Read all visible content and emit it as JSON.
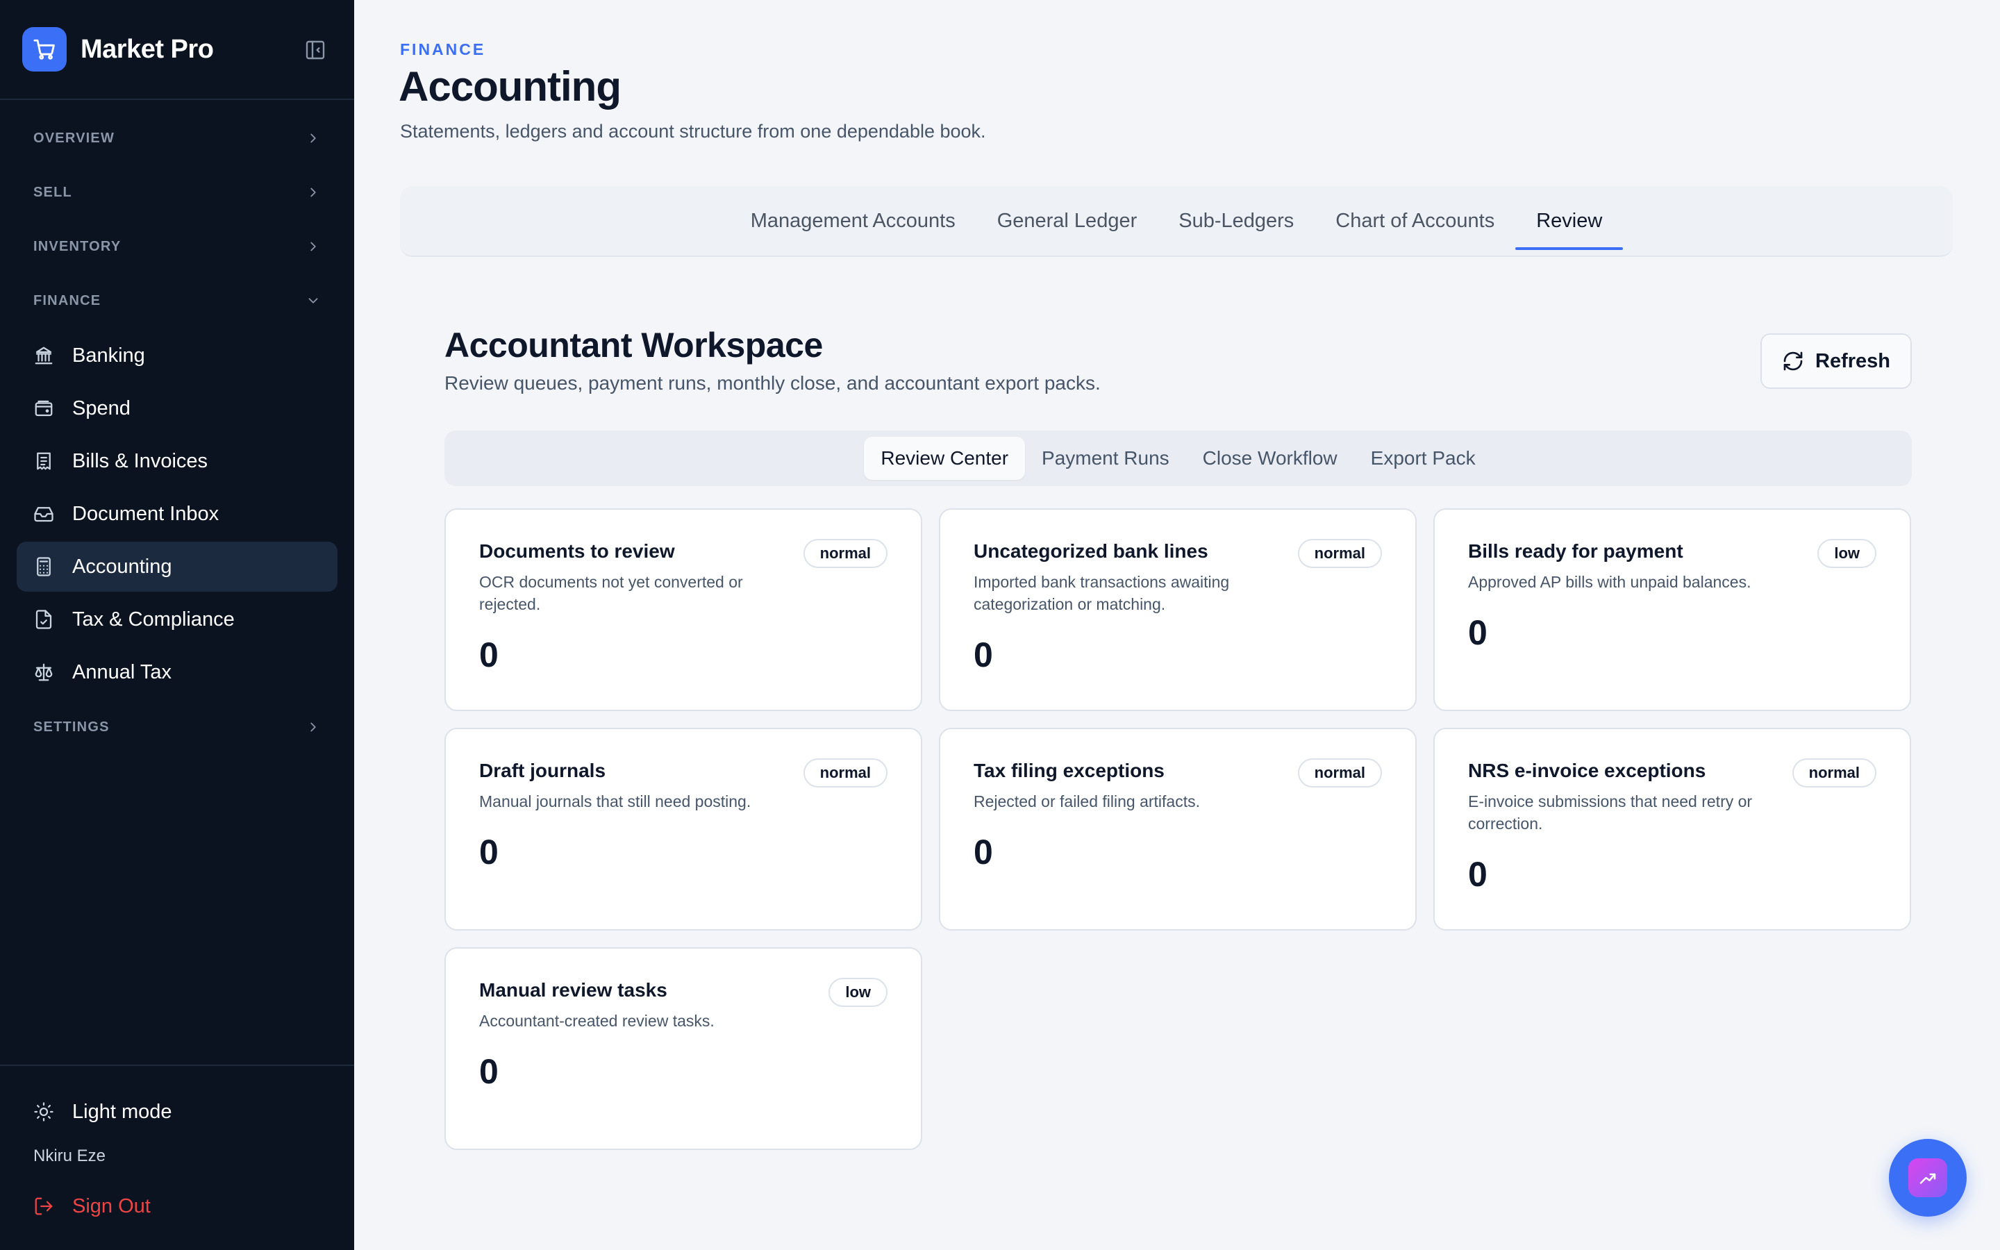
{
  "app": {
    "name": "Market Pro"
  },
  "sidebar": {
    "sections": {
      "overview": "OVERVIEW",
      "sell": "SELL",
      "inventory": "INVENTORY",
      "finance": "FINANCE",
      "settings": "SETTINGS"
    },
    "finance_items": [
      {
        "label": "Banking",
        "icon": "bank-icon"
      },
      {
        "label": "Spend",
        "icon": "wallet-icon"
      },
      {
        "label": "Bills & Invoices",
        "icon": "receipt-icon"
      },
      {
        "label": "Document Inbox",
        "icon": "inbox-icon"
      },
      {
        "label": "Accounting",
        "icon": "calculator-icon",
        "active": true
      },
      {
        "label": "Tax & Compliance",
        "icon": "file-check-icon"
      },
      {
        "label": "Annual Tax",
        "icon": "scale-icon"
      }
    ],
    "theme_label": "Light mode",
    "user_name": "Nkiru Eze",
    "signout_label": "Sign Out"
  },
  "header": {
    "eyebrow": "FINANCE",
    "title": "Accounting",
    "subtitle": "Statements, ledgers and account structure from one dependable book."
  },
  "tabs": [
    {
      "label": "Management Accounts"
    },
    {
      "label": "General Ledger"
    },
    {
      "label": "Sub-Ledgers"
    },
    {
      "label": "Chart of Accounts"
    },
    {
      "label": "Review",
      "active": true
    }
  ],
  "workspace": {
    "title": "Accountant Workspace",
    "subtitle": "Review queues, payment runs, monthly close, and accountant export packs.",
    "refresh_label": "Refresh",
    "subtabs": [
      {
        "label": "Review Center",
        "active": true
      },
      {
        "label": "Payment Runs"
      },
      {
        "label": "Close Workflow"
      },
      {
        "label": "Export Pack"
      }
    ],
    "cards": [
      {
        "title": "Documents to review",
        "desc": "OCR documents not yet converted or rejected.",
        "badge": "normal",
        "value": "0"
      },
      {
        "title": "Uncategorized bank lines",
        "desc": "Imported bank transactions awaiting categorization or matching.",
        "badge": "normal",
        "value": "0"
      },
      {
        "title": "Bills ready for payment",
        "desc": "Approved AP bills with unpaid balances.",
        "badge": "low",
        "value": "0"
      },
      {
        "title": "Draft journals",
        "desc": "Manual journals that still need posting.",
        "badge": "normal",
        "value": "0"
      },
      {
        "title": "Tax filing exceptions",
        "desc": "Rejected or failed filing artifacts.",
        "badge": "normal",
        "value": "0"
      },
      {
        "title": "NRS e-invoice exceptions",
        "desc": "E-invoice submissions that need retry or correction.",
        "badge": "normal",
        "value": "0"
      },
      {
        "title": "Manual review tasks",
        "desc": "Accountant-created review tasks.",
        "badge": "low",
        "value": "0"
      }
    ]
  },
  "colors": {
    "accent": "#3b6ff5",
    "sidebar_bg": "#0b1321",
    "danger": "#ef4444"
  }
}
